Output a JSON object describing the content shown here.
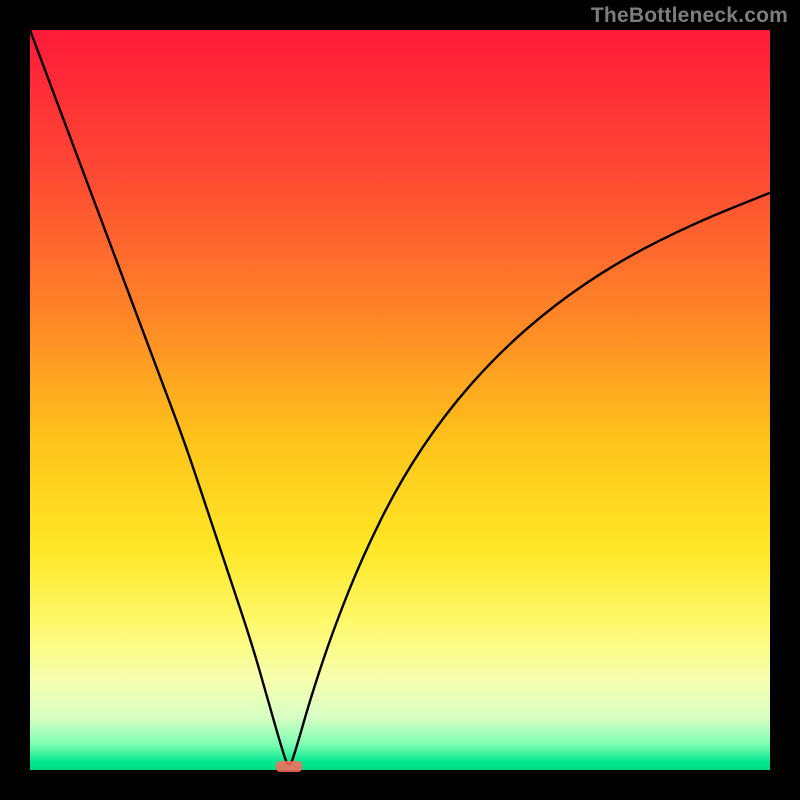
{
  "watermark": "TheBottleneck.com",
  "chart_data": {
    "type": "line",
    "title": "",
    "xlabel": "",
    "ylabel": "",
    "xlim": [
      0,
      100
    ],
    "ylim": [
      0,
      100
    ],
    "background_gradient_stops": [
      {
        "offset": 0.0,
        "color": "#ff1a3a"
      },
      {
        "offset": 0.2,
        "color": "#ff4b33"
      },
      {
        "offset": 0.4,
        "color": "#ff8a26"
      },
      {
        "offset": 0.55,
        "color": "#ffc21a"
      },
      {
        "offset": 0.7,
        "color": "#ffe726"
      },
      {
        "offset": 0.8,
        "color": "#fff96a"
      },
      {
        "offset": 0.88,
        "color": "#f6ffb0"
      },
      {
        "offset": 0.93,
        "color": "#d6ffc4"
      },
      {
        "offset": 0.965,
        "color": "#7effb4"
      },
      {
        "offset": 0.99,
        "color": "#00e78f"
      },
      {
        "offset": 1.0,
        "color": "#00d884"
      }
    ],
    "curve": {
      "description": "V-shaped bottleneck curve; minimum near x≈35",
      "x": [
        0,
        3,
        6,
        9,
        12,
        15,
        18,
        21,
        24,
        27,
        30,
        32,
        34,
        35,
        36,
        38,
        41,
        45,
        50,
        56,
        63,
        71,
        80,
        90,
        100
      ],
      "y": [
        100,
        92,
        84,
        76,
        68,
        60,
        52,
        44,
        35,
        26,
        17,
        10,
        3,
        0,
        3,
        10,
        19,
        29,
        39,
        48,
        56,
        63,
        69,
        74,
        78
      ]
    },
    "marker": {
      "x": 35,
      "y": 0,
      "color": "#ff6a5c",
      "note": "small red horizontal marker at curve minimum"
    }
  }
}
